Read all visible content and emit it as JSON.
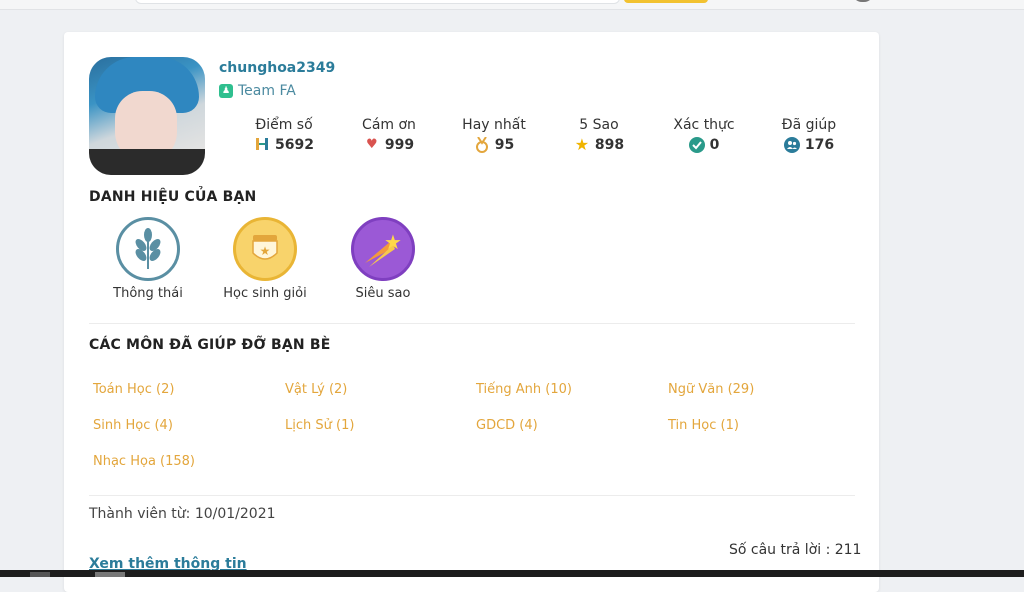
{
  "profile": {
    "username": "chunghoa2349",
    "team": "Team FA"
  },
  "stats": [
    {
      "label": "Điểm số",
      "value": "5692",
      "icon": "h-icon"
    },
    {
      "label": "Cám ơn",
      "value": "999",
      "icon": "heart-icon"
    },
    {
      "label": "Hay nhất",
      "value": "95",
      "icon": "medal-icon"
    },
    {
      "label": "5 Sao",
      "value": "898",
      "icon": "star-icon"
    },
    {
      "label": "Xác thực",
      "value": "0",
      "icon": "check-circle-icon"
    },
    {
      "label": "Đã giúp",
      "value": "176",
      "icon": "users-icon"
    }
  ],
  "titles": {
    "heading": "DANH HIỆU CỦA BẠN",
    "items": [
      {
        "name": "Thông thái",
        "icon": "wheat-icon"
      },
      {
        "name": "Học sinh giỏi",
        "icon": "medal-badge-icon"
      },
      {
        "name": "Siêu sao",
        "icon": "shooting-star-icon"
      }
    ]
  },
  "subjects": {
    "heading": "CÁC MÔN ĐÃ GIÚP ĐỠ BẠN BÈ",
    "items": [
      "Toán Học (2)",
      "Vật Lý (2)",
      "Tiếng Anh (10)",
      "Ngữ Văn (29)",
      "Sinh Học (4)",
      "Lịch Sử (1)",
      "GDCD (4)",
      "Tin Học (1)",
      "Nhạc Họa (158)"
    ]
  },
  "member_since": "Thành viên từ: 10/01/2021",
  "more_link": "Xem thêm thông tin",
  "answers": "Số câu trả lời : 211",
  "colors": {
    "accent": "#2b7c9a",
    "subject": "#e3a63c",
    "heart": "#d9534f",
    "star": "#f0b400",
    "verify": "#2a9a8a",
    "team": "#2fbf8f"
  }
}
